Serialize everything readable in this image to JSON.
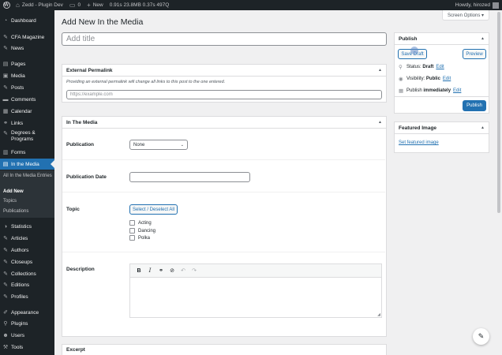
{
  "adminbar": {
    "site_name": "Zedd - Plugin Dev",
    "comments_count": "0",
    "new_label": "New",
    "query_stats": "0.91s  23.8MB  0.37s  497Q",
    "howdy": "Howdy, hirozed"
  },
  "sidebar": {
    "items": [
      {
        "label": "Dashboard",
        "icon": "dashboard-icon",
        "glyph": "◔"
      },
      {
        "label": "CFA Magazine",
        "icon": "pin-icon",
        "glyph": "✎"
      },
      {
        "label": "News",
        "icon": "pin-icon",
        "glyph": "✎"
      },
      {
        "label": "Pages",
        "icon": "pages-icon",
        "glyph": "▤"
      },
      {
        "label": "Media",
        "icon": "media-icon",
        "glyph": "▣"
      },
      {
        "label": "Posts",
        "icon": "pin-icon",
        "glyph": "✎"
      },
      {
        "label": "Comments",
        "icon": "comments-icon",
        "glyph": "▬"
      },
      {
        "label": "Calendar",
        "icon": "calendar-icon",
        "glyph": "▦"
      },
      {
        "label": "Links",
        "icon": "links-icon",
        "glyph": "⚭"
      },
      {
        "label": "Degrees &",
        "label2": "Programs",
        "icon": "pin-icon",
        "glyph": "✎"
      },
      {
        "label": "Forms",
        "icon": "forms-icon",
        "glyph": "▥"
      },
      {
        "label": "In the Media",
        "icon": "pages-icon",
        "glyph": "▤"
      },
      {
        "label": "Statistics",
        "icon": "statistics-icon",
        "glyph": "◑"
      },
      {
        "label": "Articles",
        "icon": "pin-icon",
        "glyph": "✎"
      },
      {
        "label": "Authors",
        "icon": "pin-icon",
        "glyph": "✎"
      },
      {
        "label": "Closeups",
        "icon": "pin-icon",
        "glyph": "✎"
      },
      {
        "label": "Collections",
        "icon": "pin-icon",
        "glyph": "✎"
      },
      {
        "label": "Editions",
        "icon": "pin-icon",
        "glyph": "✎"
      },
      {
        "label": "Profiles",
        "icon": "pin-icon",
        "glyph": "✎"
      },
      {
        "label": "Appearance",
        "icon": "appearance-icon",
        "glyph": "✐"
      },
      {
        "label": "Plugins",
        "icon": "plugins-icon",
        "glyph": "⚲"
      },
      {
        "label": "Users",
        "icon": "users-icon",
        "glyph": "☻"
      },
      {
        "label": "Tools",
        "icon": "tools-icon",
        "glyph": "⚒"
      }
    ],
    "submenu": {
      "all": "All In the Media Entries",
      "add_new": "Add New",
      "topics": "Topics",
      "publications": "Publications"
    }
  },
  "page": {
    "title": "Add New In the Media",
    "screen_options": "Screen Options ▾",
    "title_placeholder": "Add title"
  },
  "permalink": {
    "heading": "External Permalink",
    "description": "Providing an external permalink will change all links to this post to the one entered.",
    "placeholder": "https://example.com"
  },
  "inthemedia": {
    "heading": "In The Media",
    "publication_label": "Publication",
    "publication_value": "None",
    "date_label": "Publication Date",
    "topic_label": "Topic",
    "select_all": "Select / Deselect All",
    "topics": [
      "Acting",
      "Dancing",
      "Polka"
    ],
    "description_label": "Description"
  },
  "publish": {
    "heading": "Publish",
    "save_draft": "Save Draft",
    "preview": "Preview",
    "status_label": "Status:",
    "status_value": "Draft",
    "visibility_label": "Visibility:",
    "visibility_value": "Public",
    "publish_label": "Publish",
    "publish_value": "immediately",
    "edit": "Edit",
    "publish_button": "Publish"
  },
  "featured": {
    "heading": "Featured Image",
    "set_link": "Set featured image"
  },
  "excerpt": {
    "heading": "Excerpt"
  },
  "colors": {
    "accent": "#2271b1",
    "sidebar": "#1d2327"
  }
}
